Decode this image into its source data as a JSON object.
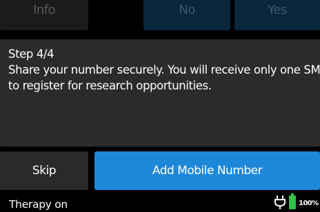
{
  "top_buttons": {
    "info_label": "Info",
    "no_label": "No",
    "yes_label": "Yes"
  },
  "dialog": {
    "step": "Step 4/4",
    "message_line1": "Share your number securely. You will receive only one SMS",
    "message_line2": "to register for research opportunities."
  },
  "actions": {
    "skip_label": "Skip",
    "add_label": "Add Mobile Number"
  },
  "status_bar": {
    "therapy_status": "Therapy on",
    "battery_percent": "100%",
    "battery_level": 1.0,
    "icons": [
      "plug-icon",
      "battery-icon"
    ]
  },
  "colors": {
    "accent": "#1e88d8",
    "battery": "#35c04c"
  }
}
